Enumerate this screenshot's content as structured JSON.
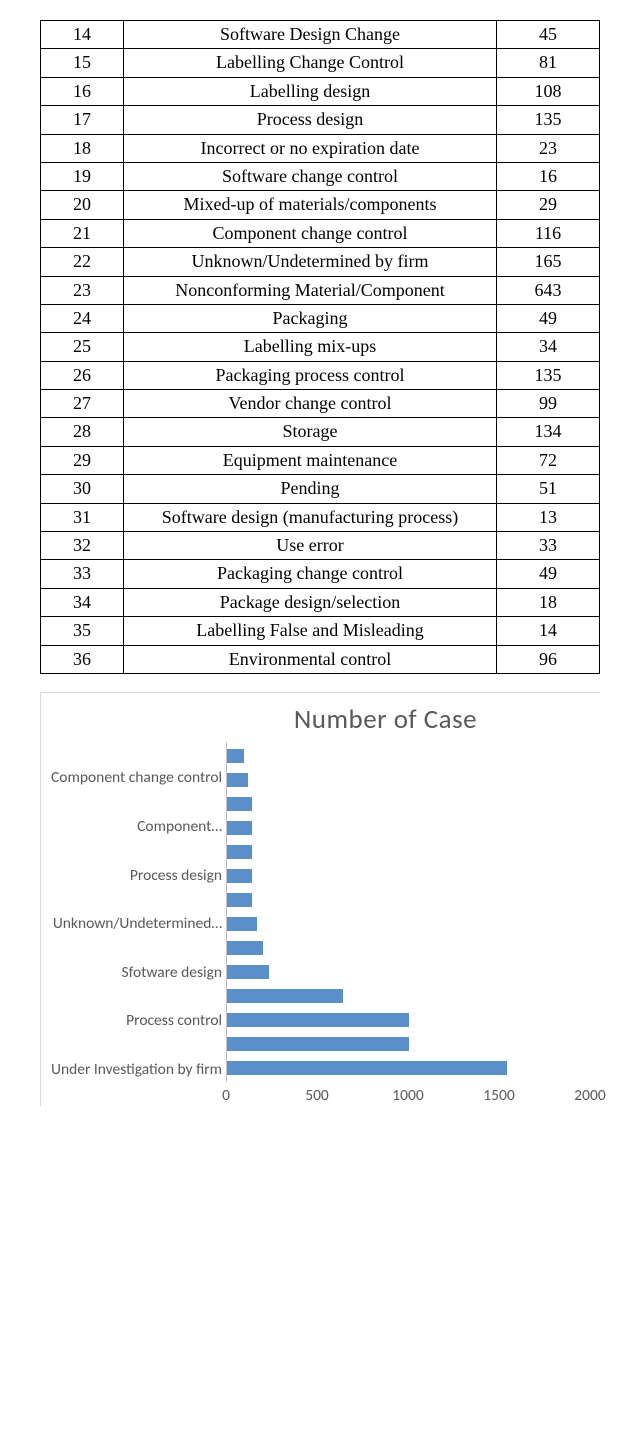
{
  "table": {
    "rows": [
      {
        "n": "14",
        "label": "Software Design Change",
        "v": "45"
      },
      {
        "n": "15",
        "label": "Labelling Change Control",
        "v": "81"
      },
      {
        "n": "16",
        "label": "Labelling design",
        "v": "108"
      },
      {
        "n": "17",
        "label": "Process design",
        "v": "135"
      },
      {
        "n": "18",
        "label": "Incorrect or no expiration date",
        "v": "23"
      },
      {
        "n": "19",
        "label": "Software change control",
        "v": "16"
      },
      {
        "n": "20",
        "label": "Mixed-up of materials/components",
        "v": "29"
      },
      {
        "n": "21",
        "label": "Component change control",
        "v": "116"
      },
      {
        "n": "22",
        "label": "Unknown/Undetermined by firm",
        "v": "165"
      },
      {
        "n": "23",
        "label": "Nonconforming Material/Component",
        "v": "643"
      },
      {
        "n": "24",
        "label": "Packaging",
        "v": "49"
      },
      {
        "n": "25",
        "label": "Labelling mix-ups",
        "v": "34"
      },
      {
        "n": "26",
        "label": "Packaging process control",
        "v": "135"
      },
      {
        "n": "27",
        "label": "Vendor change control",
        "v": "99"
      },
      {
        "n": "28",
        "label": "Storage",
        "v": "134"
      },
      {
        "n": "29",
        "label": "Equipment maintenance",
        "v": "72"
      },
      {
        "n": "30",
        "label": "Pending",
        "v": "51"
      },
      {
        "n": "31",
        "label": "Software design (manufacturing process)",
        "v": "13"
      },
      {
        "n": "32",
        "label": "Use error",
        "v": "33"
      },
      {
        "n": "33",
        "label": "Packaging change control",
        "v": "49"
      },
      {
        "n": "34",
        "label": "Package design/selection",
        "v": "18"
      },
      {
        "n": "35",
        "label": "Labelling False and Misleading",
        "v": "14"
      },
      {
        "n": "36",
        "label": "Environmental control",
        "v": "96"
      }
    ]
  },
  "chart_data": {
    "type": "bar",
    "orientation": "horizontal",
    "title": "Number of Case",
    "xlabel": "",
    "ylabel": "",
    "xlim": [
      0,
      2000
    ],
    "xticks": [
      0,
      500,
      1000,
      1500,
      2000
    ],
    "categories": [
      "",
      "Component change control",
      "",
      "Component…",
      "",
      "Process design",
      "",
      "Unknown/Undetermined…",
      "",
      "Sfotware design",
      "",
      "Process control",
      "",
      "Under Investigation by firm"
    ],
    "values": [
      95,
      115,
      135,
      135,
      135,
      135,
      135,
      165,
      200,
      230,
      640,
      1000,
      1000,
      1540
    ]
  }
}
